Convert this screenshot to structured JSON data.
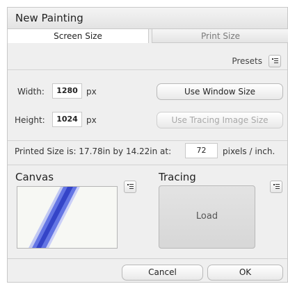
{
  "dialog": {
    "title": "New Painting"
  },
  "tabs": [
    {
      "label": "Screen Size",
      "active": true
    },
    {
      "label": "Print Size",
      "active": false
    }
  ],
  "presets": {
    "label": "Presets",
    "icon": "menu-list-icon"
  },
  "size": {
    "width_label": "Width:",
    "width_value": "1280",
    "width_unit": "px",
    "height_label": "Height:",
    "height_value": "1024",
    "height_unit": "px",
    "use_window_size": "Use Window Size",
    "use_tracing_size": "Use Tracing Image Size"
  },
  "print": {
    "prefix": "Printed Size is: 17.78in by 14.22in at:",
    "dpi": "72",
    "suffix": "pixels / inch."
  },
  "canvas": {
    "title": "Canvas",
    "menu_icon": "menu-list-icon"
  },
  "tracing": {
    "title": "Tracing",
    "load_label": "Load",
    "menu_icon": "menu-list-icon"
  },
  "footer": {
    "cancel": "Cancel",
    "ok": "OK"
  },
  "colors": {
    "dialog_bg": "#efefef",
    "stroke_blue": "#3a4fd8"
  }
}
